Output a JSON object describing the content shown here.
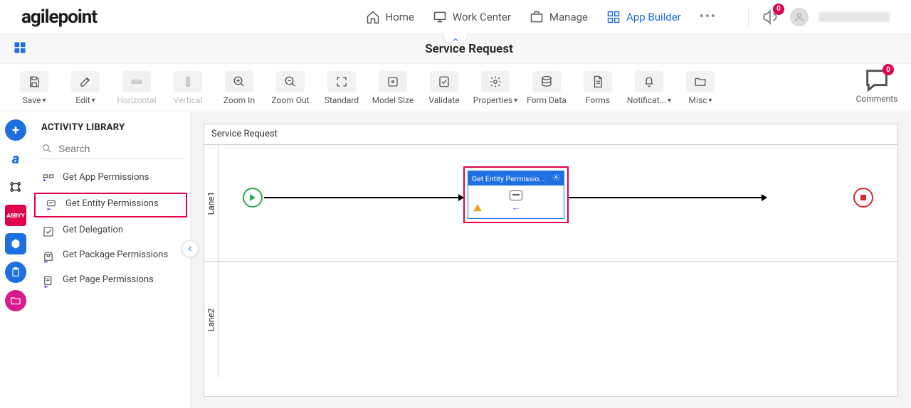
{
  "header": {
    "logo_text": "agilepoint",
    "nav": {
      "home": "Home",
      "work_center": "Work Center",
      "manage": "Manage",
      "app_builder": "App Builder"
    },
    "notification_count": "0",
    "comments_count": "0"
  },
  "page": {
    "title": "Service Request"
  },
  "toolbar": {
    "save": "Save",
    "edit": "Edit",
    "horizontal": "Horizontal",
    "vertical": "Vertical",
    "zoom_in": "Zoom In",
    "zoom_out": "Zoom Out",
    "standard": "Standard",
    "model_size": "Model Size",
    "validate": "Validate",
    "properties": "Properties",
    "form_data": "Form Data",
    "forms": "Forms",
    "notifications": "Notificat...",
    "misc": "Misc",
    "comments": "Comments"
  },
  "sidebar": {
    "title": "ACTIVITY LIBRARY",
    "search_placeholder": "Search",
    "items": [
      "Get App Permissions",
      "Get Entity Permissions",
      "Get Delegation",
      "Get Package Permissions",
      "Get Page Permissions"
    ]
  },
  "rail": {
    "abbyy": "ABBYY"
  },
  "canvas": {
    "title": "Service Request",
    "lanes": [
      "Lane1",
      "Lane2"
    ],
    "activity_label": "Get Entity Permissio..."
  }
}
